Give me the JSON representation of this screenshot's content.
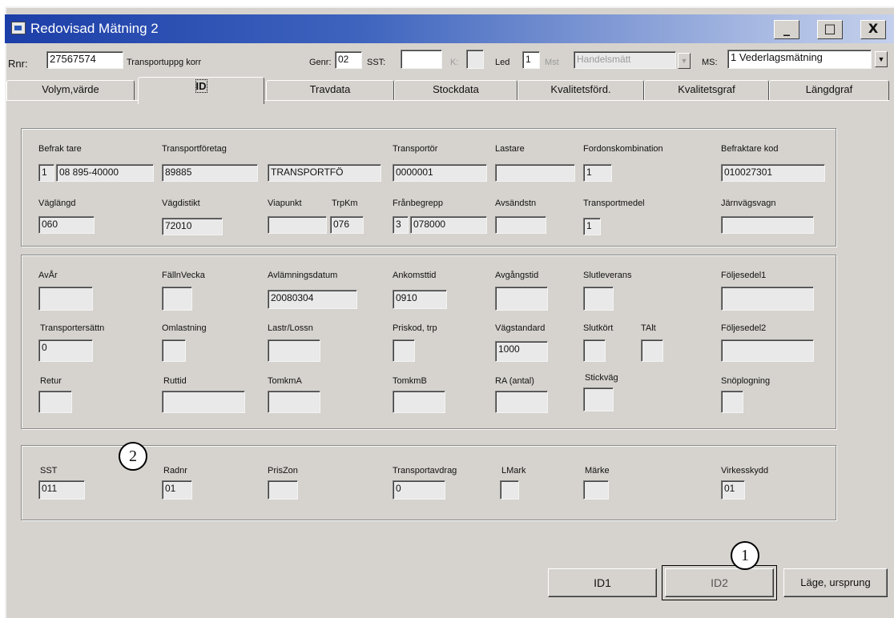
{
  "window": {
    "title": "Redovisad Mätning  2",
    "controls": {
      "minimize": "_",
      "maximize": "□",
      "close": "X"
    }
  },
  "header": {
    "rnr_label": "Rnr:",
    "rnr_value": "27567574",
    "rnr_desc": "Transportuppg korr",
    "genr_label": "Genr:",
    "genr_value": "02",
    "sst_label": "SST:",
    "sst_value": "",
    "k_label": "K:",
    "k_value": "",
    "led_label": "Led",
    "led_value": "1",
    "mst_label": "Mst",
    "mst_value": "Handelsmätt",
    "ms_label": "MS:",
    "ms_value": "1 Vederlagsmätning"
  },
  "tabs": [
    {
      "label": "Volym,värde",
      "active": false
    },
    {
      "label": "ID",
      "active": true
    },
    {
      "label": "Travdata",
      "active": false
    },
    {
      "label": "Stockdata",
      "active": false
    },
    {
      "label": "Kvalitetsförd.",
      "active": false
    },
    {
      "label": "Kvalitetsgraf",
      "active": false
    },
    {
      "label": "Längdgraf",
      "active": false
    }
  ],
  "group1": {
    "befaktare": {
      "label": "Befrak tare",
      "code": "1",
      "value": "08 895-40000"
    },
    "transportforetag": {
      "label": "Transportföretag",
      "value": "89885",
      "name": "TRANSPORTFÖ"
    },
    "transportor": {
      "label": "Transportör",
      "value": "0000001"
    },
    "lastare": {
      "label": "Lastare",
      "value": ""
    },
    "fordonskombination": {
      "label": "Fordonskombination",
      "value": "1"
    },
    "befaktare_kod": {
      "label": "Befraktare kod",
      "value": "010027301"
    },
    "vaglangd": {
      "label": "Väglängd",
      "value": "060"
    },
    "vagdistrikt": {
      "label": "Vägdistikt",
      "value": "72010"
    },
    "viapunkt": {
      "label": "Viapunkt",
      "value": ""
    },
    "trpkm": {
      "label": "TrpKm",
      "value": "076"
    },
    "franbegrepp": {
      "label": "Frånbegrepp",
      "code": "3",
      "value": "078000"
    },
    "avsandstn": {
      "label": "Avsändstn",
      "value": ""
    },
    "transportmedel": {
      "label": "Transportmedel",
      "value": "1"
    },
    "jarnvagsvagn": {
      "label": "Järnvägsvagn",
      "value": ""
    }
  },
  "group2": {
    "avar": {
      "label": "AvÅr",
      "value": ""
    },
    "fallvecka": {
      "label": "FällnVecka",
      "value": ""
    },
    "avlamningsdatum": {
      "label": "Avlämningsdatum",
      "value": "20080304"
    },
    "ankomsttid": {
      "label": "Ankomsttid",
      "value": "0910"
    },
    "avgangstid": {
      "label": "Avgångstid",
      "value": ""
    },
    "slutleverans": {
      "label": "Slutleverans",
      "value": ""
    },
    "foljesedel1": {
      "label": "Följesedel1",
      "value": ""
    },
    "transportersattn": {
      "label": "Transportersättn",
      "value": "0"
    },
    "omlastning": {
      "label": "Omlastning",
      "value": ""
    },
    "lastr_lossn": {
      "label": "Lastr/Lossn",
      "value": ""
    },
    "priskod_trp": {
      "label": "Priskod, trp",
      "value": ""
    },
    "vagstandard": {
      "label": "Vägstandard",
      "value": "1000"
    },
    "slutkort": {
      "label": "Slutkört",
      "value": ""
    },
    "talt": {
      "label": "TAlt",
      "value": ""
    },
    "foljesedel2": {
      "label": "Följesedel2",
      "value": ""
    },
    "retur": {
      "label": "Retur",
      "value": ""
    },
    "ruttid": {
      "label": "Ruttid",
      "value": ""
    },
    "tomkma": {
      "label": "TomkmA",
      "value": ""
    },
    "tomkmb": {
      "label": "TomkmB",
      "value": ""
    },
    "ra_antal": {
      "label": "RA (antal)",
      "value": ""
    },
    "stickvag": {
      "label": "Stickväg",
      "value": ""
    },
    "snoplogning": {
      "label": "Snöplogning",
      "value": ""
    }
  },
  "group3": {
    "sst": {
      "label": "SST",
      "value": "011"
    },
    "radnr": {
      "label": "Radnr",
      "value": "01"
    },
    "priszon": {
      "label": "PrisZon",
      "value": ""
    },
    "transportavdrag": {
      "label": "Transportavdrag",
      "value": "0"
    },
    "lmark": {
      "label": "LMark",
      "value": ""
    },
    "marke": {
      "label": "Märke",
      "value": ""
    },
    "virkesskydd": {
      "label": "Virkesskydd",
      "value": "01"
    }
  },
  "buttons": {
    "id1": "ID1",
    "id2": "ID2",
    "lage_ursprung": "Läge, ursprung"
  },
  "callouts": {
    "one": "1",
    "two": "2"
  }
}
